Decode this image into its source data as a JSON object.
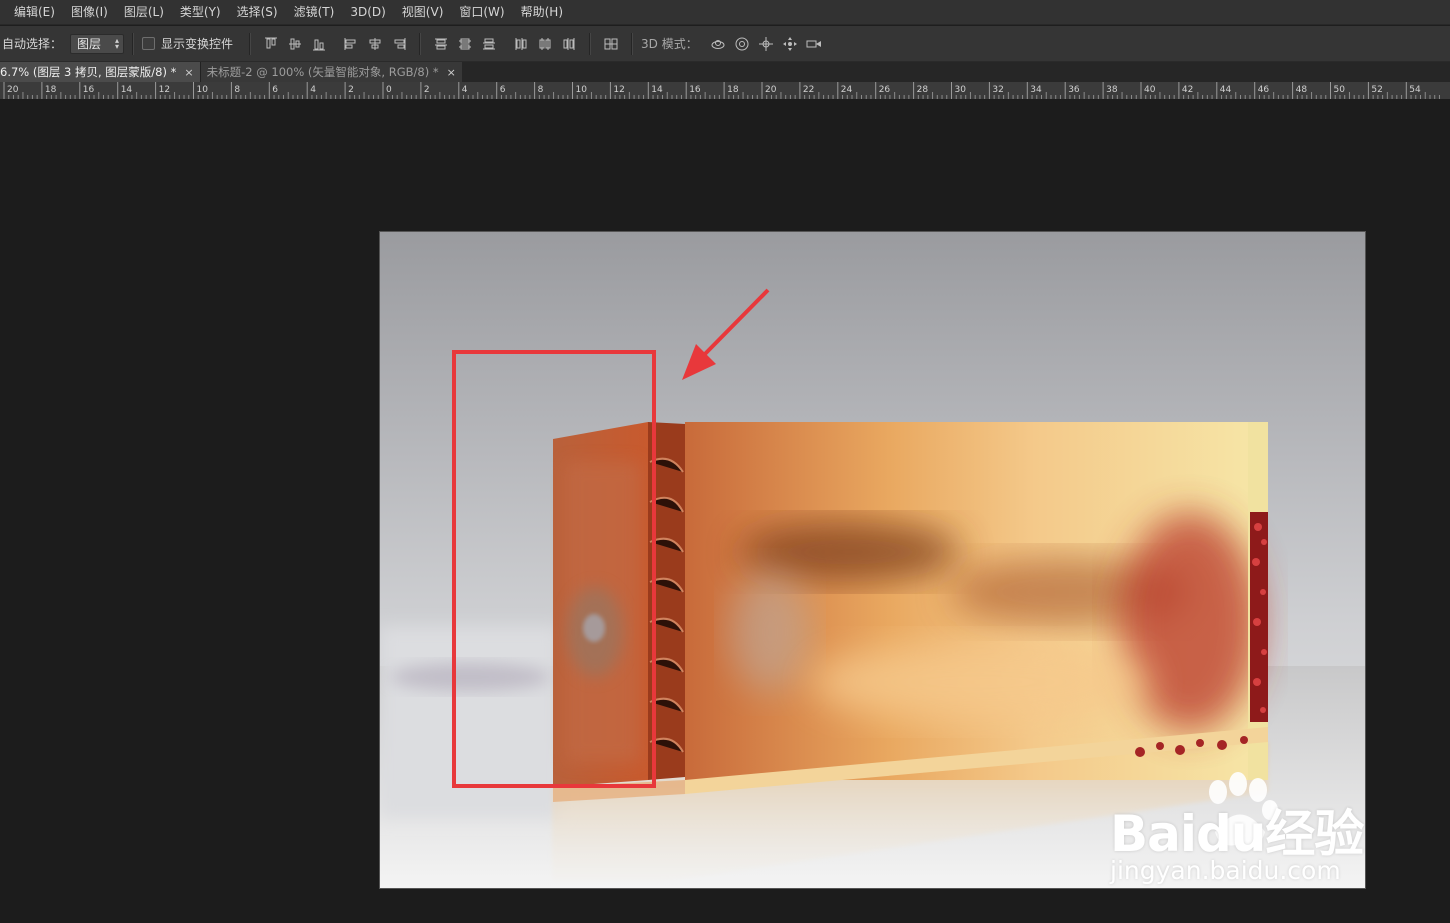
{
  "menu": {
    "items": [
      "编辑(E)",
      "图像(I)",
      "图层(L)",
      "类型(Y)",
      "选择(S)",
      "滤镜(T)",
      "3D(D)",
      "视图(V)",
      "窗口(W)",
      "帮助(H)"
    ]
  },
  "options_bar": {
    "auto_select_label": "自动选择：",
    "auto_select_value": "图层",
    "show_transform_label": "显示变换控件",
    "show_transform_checked": false,
    "mode_3d_label": "3D 模式："
  },
  "tabs": [
    {
      "label": "6.7% (图层 3 拷贝, 图层蒙版/8) *",
      "active": true,
      "close": "×"
    },
    {
      "label": "未标题-2 @ 100% (矢量智能对象, RGB/8) *",
      "active": false,
      "close": "×"
    }
  ],
  "ruler": {
    "labels": [
      "20",
      "18",
      "16",
      "14",
      "12",
      "10",
      "8",
      "6",
      "4",
      "2",
      "0",
      "2",
      "4",
      "6",
      "8",
      "10",
      "12",
      "14",
      "16",
      "18",
      "20",
      "22",
      "24",
      "26",
      "28",
      "30",
      "32",
      "34",
      "36",
      "38",
      "40",
      "42",
      "44",
      "46",
      "48",
      "50",
      "52",
      "54"
    ]
  },
  "annotation": {
    "highlight_color": "#e8383b",
    "arrow_color": "#e8383b"
  },
  "watermark": {
    "brand_text": "Baidu经验",
    "url": "jingyan.baidu.com"
  },
  "icons": {
    "align": [
      "align-top-edges-icon",
      "align-vertical-centers-icon",
      "align-bottom-edges-icon",
      "align-left-edges-icon",
      "align-horizontal-centers-icon",
      "align-right-edges-icon"
    ],
    "distribute": [
      "distribute-top-icon",
      "distribute-vertical-centers-icon",
      "distribute-bottom-icon",
      "distribute-left-icon",
      "distribute-horizontal-centers-icon",
      "distribute-right-icon"
    ],
    "auto_align": "auto-align-layers-icon",
    "mode_3d": [
      "3d-rotate-icon",
      "3d-roll-icon",
      "3d-pan-icon",
      "3d-slide-icon",
      "3d-scale-icon"
    ]
  }
}
